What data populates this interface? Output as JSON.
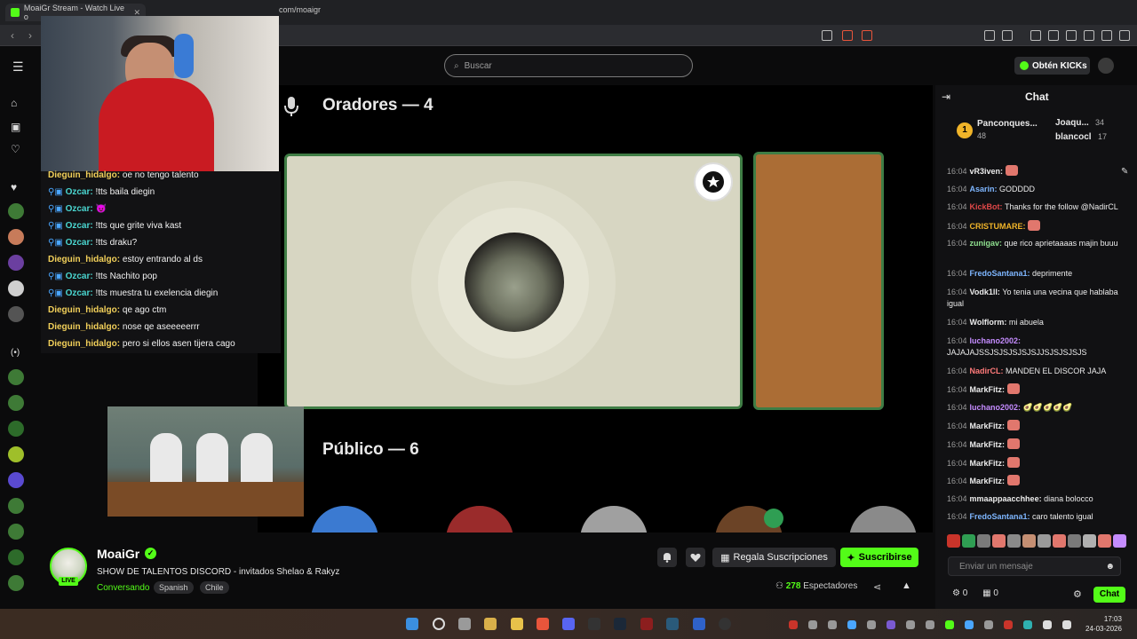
{
  "browser": {
    "tab_title": "MoaiGr Stream - Watch Live o",
    "tab_close": "✕",
    "url": "com/moaigr",
    "back": "‹",
    "forward": "›"
  },
  "header": {
    "menu_icon": "hamburger-icon",
    "search_placeholder": "Buscar",
    "kicks_label": "Obtén KICKs"
  },
  "stage": {
    "speakers_heading": "Oradores — 4",
    "audience_heading": "Público — 6"
  },
  "overlay_chat": [
    {
      "user": "Dieguin_hidalgo:",
      "text": "oe no tengo talento",
      "badge": false
    },
    {
      "user": "Ozcar:",
      "text": "!tts baila diegin",
      "badge": true
    },
    {
      "user": "Ozcar:",
      "text": "😈",
      "badge": true
    },
    {
      "user": "Ozcar:",
      "text": "!tts que grite viva kast",
      "badge": true
    },
    {
      "user": "Ozcar:",
      "text": "!tts draku?",
      "badge": true
    },
    {
      "user": "Dieguin_hidalgo:",
      "text": "estoy entrando al ds",
      "badge": false
    },
    {
      "user": "Ozcar:",
      "text": "!tts Nachito pop",
      "badge": true
    },
    {
      "user": "Ozcar:",
      "text": "!tts muestra tu exelencia diegin",
      "badge": true
    },
    {
      "user": "Dieguin_hidalgo:",
      "text": "qe ago ctm",
      "badge": false
    },
    {
      "user": "Dieguin_hidalgo:",
      "text": "nose qe aseeeeerrr",
      "badge": false
    },
    {
      "user": "Dieguin_hidalgo:",
      "text": "pero si ellos asen tijera cago",
      "badge": false
    }
  ],
  "channel": {
    "name": "MoaiGr",
    "live_badge": "LIVE",
    "title": "SHOW DE TALENTOS DISCORD - invitados Shelao & Rakyz",
    "category": "Conversando",
    "tags": [
      "Spanish",
      "Chile"
    ],
    "gift_label": "Regala Suscripciones",
    "subscribe_label": "Suscribirse",
    "viewers_count": "278",
    "viewers_label": "Espectadores"
  },
  "chat": {
    "title": "Chat",
    "leaderboard": [
      {
        "rank": "1",
        "name": "Panconques...",
        "count": "48",
        "color": "#f0b429"
      },
      {
        "name": "Joaqu...",
        "count": "34",
        "color": "#e9e9e9"
      },
      {
        "name": "blancocl",
        "count": "17",
        "color": "#f0b429"
      }
    ],
    "messages": [
      {
        "ts": "16:04",
        "user": "vR3iven:",
        "color": "#ececec",
        "text": "",
        "emote": true
      },
      {
        "ts": "16:04",
        "user": "Asarin:",
        "color": "#7eb6ff",
        "text": "GODDDD",
        "emote": false
      },
      {
        "ts": "16:04",
        "user": "KickBot:",
        "color": "#e04848",
        "text": "Thanks for the follow @NadirCL",
        "emote": false
      },
      {
        "ts": "16:04",
        "user": "CRISTUMARE:",
        "color": "#f0b429",
        "text": "",
        "emote": true
      },
      {
        "ts": "16:04",
        "user": "zunigav:",
        "color": "#8fe08f",
        "text": "que rico aprietaaaas majin buuu",
        "emote": false
      },
      {
        "ts": "16:04",
        "user": "FredoSantana1:",
        "color": "#7eb6ff",
        "text": "deprimente",
        "emote": false
      },
      {
        "ts": "16:04",
        "user": "Vodk1ll:",
        "color": "#ececec",
        "text": "Yo tenia una vecina que hablaba igual",
        "emote": false
      },
      {
        "ts": "16:04",
        "user": "Wolflorm:",
        "color": "#ececec",
        "text": "mi abuela",
        "emote": false
      },
      {
        "ts": "16:04",
        "user": "luchano2002:",
        "color": "#c58cff",
        "text": "JAJAJAJSSJSJSJSJSJSJJSJSJSJSJS",
        "emote": false
      },
      {
        "ts": "16:04",
        "user": "NadirCL:",
        "color": "#ff7a7a",
        "text": "MANDEN EL DISCOR JAJA",
        "emote": false
      },
      {
        "ts": "16:04",
        "user": "MarkFitz:",
        "color": "#ececec",
        "text": "",
        "emote": true
      },
      {
        "ts": "16:04",
        "user": "luchano2002:",
        "color": "#c58cff",
        "text": "🥑🥑🥑🥑🥑",
        "emote": false
      },
      {
        "ts": "16:04",
        "user": "MarkFitz:",
        "color": "#ececec",
        "text": "",
        "emote": true
      },
      {
        "ts": "16:04",
        "user": "MarkFitz:",
        "color": "#ececec",
        "text": "",
        "emote": true
      },
      {
        "ts": "16:04",
        "user": "MarkFitz:",
        "color": "#ececec",
        "text": "",
        "emote": true
      },
      {
        "ts": "16:04",
        "user": "MarkFitz:",
        "color": "#ececec",
        "text": "",
        "emote": true
      },
      {
        "ts": "16:04",
        "user": "mmaappaacchhee:",
        "color": "#ececec",
        "text": "diana bolocco",
        "emote": false
      },
      {
        "ts": "16:04",
        "user": "FredoSantana1:",
        "color": "#7eb6ff",
        "text": "caro talento igual",
        "emote": false
      }
    ],
    "input_placeholder": "Enviar un mensaje",
    "kicks_count": "0",
    "gifts_count": "0",
    "send_label": "Chat"
  },
  "taskbar": {
    "time": "17:03",
    "date": "24-03-2026"
  }
}
